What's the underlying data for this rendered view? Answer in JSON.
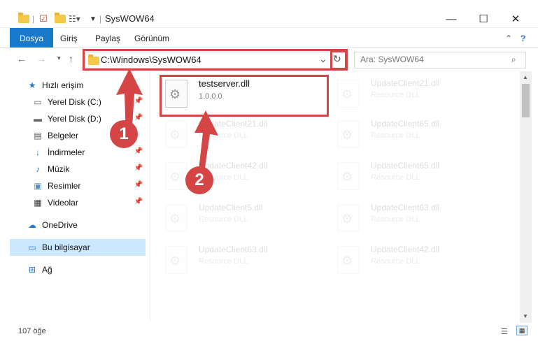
{
  "window": {
    "title": "SysWOW64",
    "minimize": "—",
    "maximize": "☐",
    "close": "✕",
    "help": "?",
    "collapse": "⌃"
  },
  "ribbon": {
    "tabs": [
      "Dosya",
      "Giriş",
      "Paylaş",
      "Görünüm"
    ]
  },
  "address": {
    "path": "C:\\Windows\\SysWOW64",
    "dropdown": "⌄",
    "refresh": "↻"
  },
  "search": {
    "placeholder": "Ara: SysWOW64",
    "icon": "search-icon"
  },
  "sidebar": {
    "items": [
      {
        "label": "Hızlı erişim",
        "icon": "star-icon"
      },
      {
        "label": "Yerel Disk (C:)",
        "icon": "drive-icon"
      },
      {
        "label": "Yerel Disk (D:)",
        "icon": "drive-icon"
      },
      {
        "label": "Belgeler",
        "icon": "documents-icon"
      },
      {
        "label": "İndirmeler",
        "icon": "download-icon"
      },
      {
        "label": "Müzik",
        "icon": "music-icon"
      },
      {
        "label": "Resimler",
        "icon": "pictures-icon"
      },
      {
        "label": "Videolar",
        "icon": "video-icon"
      },
      {
        "label": "OneDrive",
        "icon": "cloud-icon"
      },
      {
        "label": "Bu bilgisayar",
        "icon": "computer-icon"
      },
      {
        "label": "Ağ",
        "icon": "network-icon"
      }
    ]
  },
  "files": {
    "main": {
      "name": "testserver.dll",
      "desc": "1.0.0.0"
    },
    "faded": [
      {
        "name": "UpdateClient21.dll",
        "desc": "Resource DLL"
      },
      {
        "name": "UpdateClient21.dll",
        "desc": "Resource DLL"
      },
      {
        "name": "UpdateClient65.dll",
        "desc": "Resource DLL"
      },
      {
        "name": "UpdateClient42.dll",
        "desc": "Resource DLL"
      },
      {
        "name": "UpdateClient65.dll",
        "desc": "Resource DLL"
      },
      {
        "name": "UpdateClient5.dll",
        "desc": "Resource DLL"
      },
      {
        "name": "UpdateClient63.dll",
        "desc": "Resource DLL"
      },
      {
        "name": "UpdateClient63.dll",
        "desc": "Resource DLL"
      },
      {
        "name": "UpdateClient42.dll",
        "desc": "Resource DLL"
      }
    ]
  },
  "status": {
    "count": "107 öğe"
  },
  "annotations": {
    "step1": "1",
    "step2": "2",
    "color": "#d64545"
  },
  "colors": {
    "accent": "#1979ca",
    "selection": "#cce8ff"
  }
}
